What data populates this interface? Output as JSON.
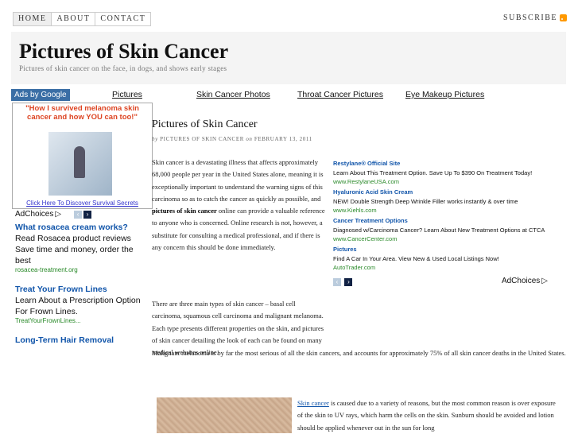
{
  "nav": {
    "home": "HOME",
    "about": "ABOUT",
    "contact": "CONTACT",
    "subscribe": "SUBSCRIBE"
  },
  "site": {
    "title": "Pictures of Skin Cancer",
    "description": "Pictures of skin cancer on the face, in dogs, and shows early stages"
  },
  "adbar": {
    "label": "Ads by Google",
    "links": [
      "Pictures",
      "Skin Cancer Photos",
      "Throat Cancer Pictures",
      "Eye Makeup Pictures"
    ]
  },
  "left_ad": {
    "headline": "\"How I survived melanoma skin cancer and how YOU can too!\"",
    "cta": "Click Here To Discover Survival Secrets"
  },
  "adchoices": "AdChoices",
  "sidebar_ads": [
    {
      "title": "What rosacea cream works?",
      "desc": "Read Rosacea product reviews Save time and money, order the best",
      "url": "rosacea-treatment.org"
    },
    {
      "title": "Treat Your Frown Lines",
      "desc": "Learn About a Prescription Option For Frown Lines.",
      "url": "TreatYourFrownLines..."
    },
    {
      "title": "Long-Term Hair Removal",
      "desc": "",
      "url": ""
    }
  ],
  "post": {
    "title": "Pictures of Skin Cancer",
    "by": "by",
    "author": "PICTURES OF SKIN CANCER",
    "on": "on",
    "date": "FEBRUARY 13, 2011",
    "p1a": "Skin cancer is a devastating illness that affects approximately 68,000 people per year in the United States alone, meaning it is exceptionally important to understand the warning signs of this carcinoma so as to catch the cancer as quickly as possible, and ",
    "p1b": "pictures of skin cancer",
    "p1c": " online can provide a valuable reference to anyone who is concerned. Online research is not, however, a substitute for consulting a medical professional, and if there is any concern this should be done immediately.",
    "p2a": "There are three main types of skin cancer – basal cell carcinoma, squamous cell carcinoma and malignant melanoma. Each type presents different properties on the skin, and pictures of skin cancer detailing the look of each can be found on many medical websites online.",
    "p2b": "Malignant melanoma is by far the most serious of all the skin cancers, and accounts for approximately 75% of all skin cancer deaths in the United States.",
    "p3link": "Skin cancer",
    "p3": " is caused due to a variety of reasons, but the most common reason is over exposure of the skin to UV rays, which harm the cells on the skin. Sunburn should be avoided and lotion should be applied whenever out in the sun for long"
  },
  "right_ads": [
    {
      "title": "Restylane® Official Site",
      "desc": "Learn About This Treatment Option. Save Up To $390 On Treatment Today!",
      "url": "www.RestylaneUSA.com"
    },
    {
      "title": "Hyaluronic Acid Skin Cream",
      "desc": "NEW! Double Strength Deep Wrinkle Filler works instantly & over time",
      "url": "www.Kiehls.com"
    },
    {
      "title": "Cancer Treatment Options",
      "desc": "Diagnosed w/Carcinoma Cancer? Learn About New Treatment Options at CTCA",
      "url": "www.CancerCenter.com"
    },
    {
      "title": "Pictures",
      "desc": "Find A Car In Your Area. View New & Used Local Listings Now!",
      "url": "AutoTrader.com"
    }
  ]
}
